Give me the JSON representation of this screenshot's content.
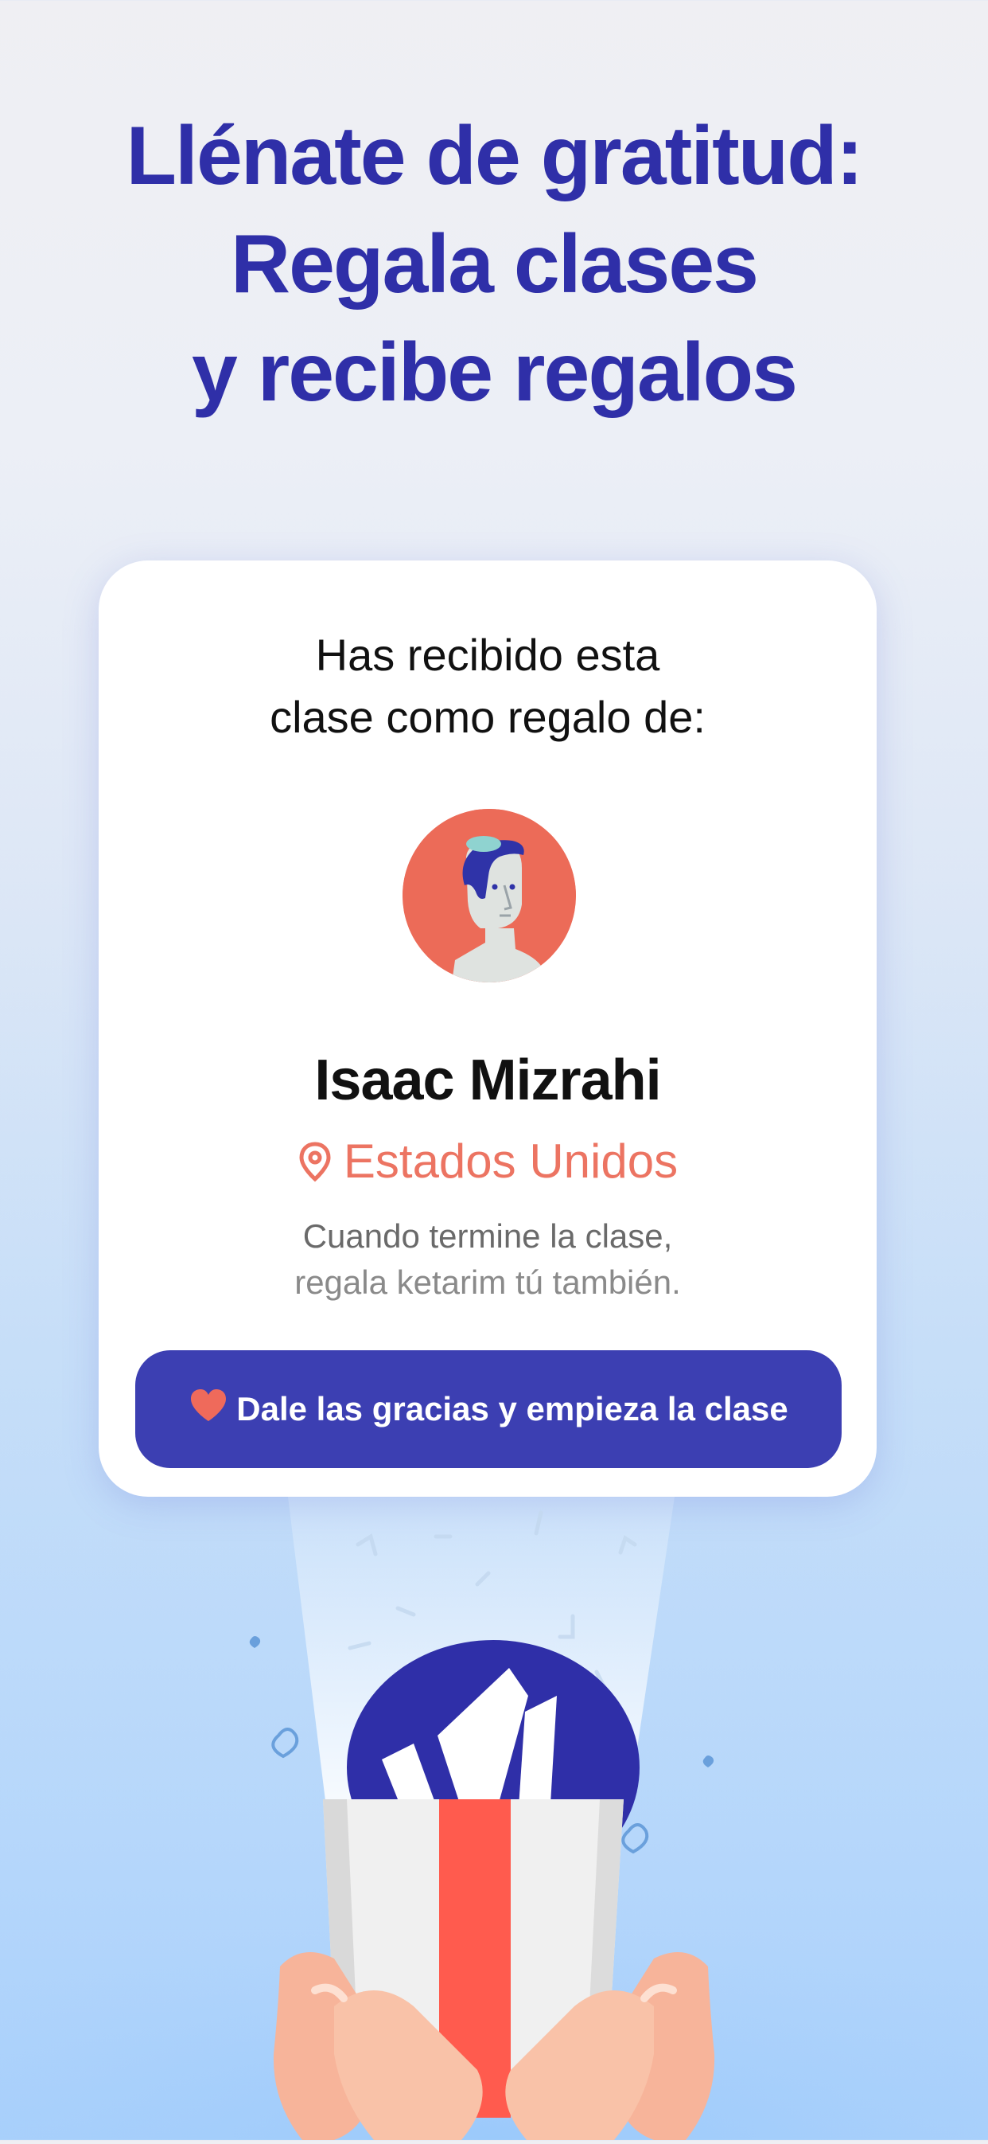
{
  "headline": {
    "line1": "Llénate de gratitud:",
    "line2": "Regala clases",
    "line3": "y recibe regalos"
  },
  "card": {
    "intro_line1": "Has recibido esta",
    "intro_line2": "clase como regalo de:",
    "name": "Isaac Mizrahi",
    "location": "Estados Unidos",
    "note_line1": "Cuando termine la clase,",
    "note_line2": "regala ketarim tú también.",
    "cta_label": "Dale las gracias y empieza la clase"
  },
  "colors": {
    "headline": "#2f2fa8",
    "cta_background": "#3c3fb2",
    "location": "#ec7462",
    "avatar_background": "#ec6b58",
    "ribbon": "#ff5b4e"
  },
  "icons": {
    "location": "map-pin-icon",
    "cta": "heart-icon",
    "logo": "crown-logo"
  }
}
